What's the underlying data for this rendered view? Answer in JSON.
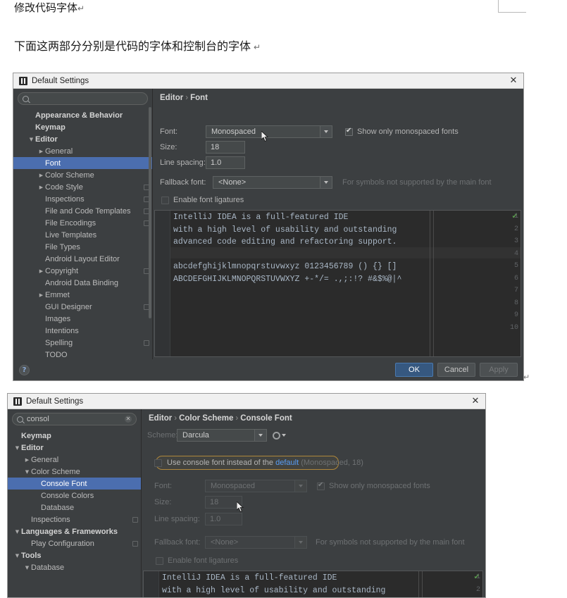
{
  "document": {
    "title": "修改代码字体",
    "subtitle": "下面这两部分分别是代码的字体和控制台的字体",
    "pilcrow": "↵"
  },
  "dialog1": {
    "titlebar": {
      "title": "Default Settings",
      "close": "✕",
      "icon": "intellij-logo-icon"
    },
    "search": {
      "value": "",
      "placeholder": ""
    },
    "tree": [
      {
        "label": "Appearance & Behavior",
        "indent": 0,
        "twisty": "",
        "bold": true,
        "selected": false,
        "badge": false
      },
      {
        "label": "Keymap",
        "indent": 0,
        "twisty": "",
        "bold": true,
        "selected": false,
        "badge": false
      },
      {
        "label": "Editor",
        "indent": 0,
        "twisty": "▼",
        "bold": true,
        "selected": false,
        "badge": false
      },
      {
        "label": "General",
        "indent": 1,
        "twisty": "▶",
        "bold": false,
        "selected": false,
        "badge": false
      },
      {
        "label": "Font",
        "indent": 1,
        "twisty": "",
        "bold": false,
        "selected": true,
        "badge": false
      },
      {
        "label": "Color Scheme",
        "indent": 1,
        "twisty": "▶",
        "bold": false,
        "selected": false,
        "badge": false
      },
      {
        "label": "Code Style",
        "indent": 1,
        "twisty": "▶",
        "bold": false,
        "selected": false,
        "badge": true
      },
      {
        "label": "Inspections",
        "indent": 1,
        "twisty": "",
        "bold": false,
        "selected": false,
        "badge": true
      },
      {
        "label": "File and Code Templates",
        "indent": 1,
        "twisty": "",
        "bold": false,
        "selected": false,
        "badge": true
      },
      {
        "label": "File Encodings",
        "indent": 1,
        "twisty": "",
        "bold": false,
        "selected": false,
        "badge": true
      },
      {
        "label": "Live Templates",
        "indent": 1,
        "twisty": "",
        "bold": false,
        "selected": false,
        "badge": false
      },
      {
        "label": "File Types",
        "indent": 1,
        "twisty": "",
        "bold": false,
        "selected": false,
        "badge": false
      },
      {
        "label": "Android Layout Editor",
        "indent": 1,
        "twisty": "",
        "bold": false,
        "selected": false,
        "badge": false
      },
      {
        "label": "Copyright",
        "indent": 1,
        "twisty": "▶",
        "bold": false,
        "selected": false,
        "badge": true
      },
      {
        "label": "Android Data Binding",
        "indent": 1,
        "twisty": "",
        "bold": false,
        "selected": false,
        "badge": false
      },
      {
        "label": "Emmet",
        "indent": 1,
        "twisty": "▶",
        "bold": false,
        "selected": false,
        "badge": false
      },
      {
        "label": "GUI Designer",
        "indent": 1,
        "twisty": "",
        "bold": false,
        "selected": false,
        "badge": true
      },
      {
        "label": "Images",
        "indent": 1,
        "twisty": "",
        "bold": false,
        "selected": false,
        "badge": false
      },
      {
        "label": "Intentions",
        "indent": 1,
        "twisty": "",
        "bold": false,
        "selected": false,
        "badge": false
      },
      {
        "label": "Spelling",
        "indent": 1,
        "twisty": "",
        "bold": false,
        "selected": false,
        "badge": true
      },
      {
        "label": "TODO",
        "indent": 1,
        "twisty": "",
        "bold": false,
        "selected": false,
        "badge": false
      }
    ],
    "breadcrumb": {
      "root": "Editor",
      "sep": "›",
      "leaf": "Font"
    },
    "form": {
      "font_label": "Font:",
      "font_value": "Monospaced",
      "show_only_monospaced": "Show only monospaced fonts",
      "show_only_monospaced_checked": true,
      "size_label": "Size:",
      "size_value": "18",
      "line_spacing_label": "Line spacing:",
      "line_spacing_value": "1.0",
      "fallback_label": "Fallback font:",
      "fallback_value": "<None>",
      "fallback_hint": "For symbols not supported by the main font",
      "ligatures_label": "Enable font ligatures",
      "ligatures_checked": false
    },
    "preview": {
      "line_numbers": [
        "1",
        "2",
        "3",
        "4",
        "5",
        "6",
        "7",
        "8",
        "9",
        "10"
      ],
      "lines": [
        "IntelliJ IDEA is a full-featured IDE",
        "with a high level of usability and outstanding",
        "advanced code editing and refactoring support.",
        "",
        "abcdefghijklmnopqrstuvwxyz 0123456789 () {} []",
        "ABCDEFGHIJKLMNOPQRSTUVWXYZ +-*/= .,;:!? #&$%@|^"
      ],
      "inspection_mark": "✔"
    },
    "footer": {
      "help": "?",
      "ok": "OK",
      "cancel": "Cancel",
      "apply": "Apply"
    }
  },
  "dialog2": {
    "titlebar": {
      "title": "Default Settings",
      "close": "✕",
      "icon": "intellij-logo-icon"
    },
    "search": {
      "value": "consol",
      "clear": "✕"
    },
    "tree": [
      {
        "label": "Keymap",
        "indent": 0,
        "twisty": "",
        "bold": true,
        "selected": false,
        "badge": false
      },
      {
        "label": "Editor",
        "indent": 0,
        "twisty": "▼",
        "bold": true,
        "selected": false,
        "badge": false
      },
      {
        "label": "General",
        "indent": 1,
        "twisty": "▶",
        "bold": false,
        "selected": false,
        "badge": false
      },
      {
        "label": "Color Scheme",
        "indent": 1,
        "twisty": "▼",
        "bold": false,
        "selected": false,
        "badge": false
      },
      {
        "label": "Console Font",
        "indent": 2,
        "twisty": "",
        "bold": false,
        "selected": true,
        "badge": false
      },
      {
        "label": "Console Colors",
        "indent": 2,
        "twisty": "",
        "bold": false,
        "selected": false,
        "badge": false
      },
      {
        "label": "Database",
        "indent": 2,
        "twisty": "",
        "bold": false,
        "selected": false,
        "badge": false
      },
      {
        "label": "Inspections",
        "indent": 1,
        "twisty": "",
        "bold": false,
        "selected": false,
        "badge": true
      },
      {
        "label": "Languages & Frameworks",
        "indent": 0,
        "twisty": "▼",
        "bold": true,
        "selected": false,
        "badge": false
      },
      {
        "label": "Play Configuration",
        "indent": 1,
        "twisty": "",
        "bold": false,
        "selected": false,
        "badge": true
      },
      {
        "label": "Tools",
        "indent": 0,
        "twisty": "▼",
        "bold": true,
        "selected": false,
        "badge": false
      },
      {
        "label": "Database",
        "indent": 1,
        "twisty": "▼",
        "bold": false,
        "selected": false,
        "badge": false
      }
    ],
    "breadcrumb": {
      "root": "Editor",
      "sep": "›",
      "mid": "Color Scheme",
      "leaf": "Console Font"
    },
    "scheme": {
      "label": "Scheme:",
      "value": "Darcula",
      "gear": "gear-icon"
    },
    "form": {
      "use_console_font_prefix": "Use console font instead of the ",
      "use_console_font_link": "default",
      "use_console_font_suffix": " (Monospaced, 18)",
      "use_console_font_checked": false,
      "font_label": "Font:",
      "font_value": "Monospaced",
      "show_only_monospaced": "Show only monospaced fonts",
      "show_only_monospaced_checked": true,
      "size_label": "Size:",
      "size_value": "18",
      "line_spacing_label": "Line spacing:",
      "line_spacing_value": "1.0",
      "fallback_label": "Fallback font:",
      "fallback_value": "<None>",
      "fallback_hint": "For symbols not supported by the main font",
      "ligatures_label": "Enable font ligatures",
      "ligatures_checked": false
    },
    "preview": {
      "line_numbers": [
        "1",
        "2"
      ],
      "lines": [
        "IntelliJ IDEA is a full-featured IDE",
        "with a high level of usability and outstanding"
      ],
      "inspection_mark": "✔"
    }
  },
  "colors": {
    "dialog_bg": "#3c3f41",
    "selection": "#4b6eaf",
    "primary_button": "#365880",
    "editor_bg": "#2b2b2b",
    "code_text": "#a9b7c6",
    "link": "#589df6",
    "highlight_border": "#b0883b"
  }
}
